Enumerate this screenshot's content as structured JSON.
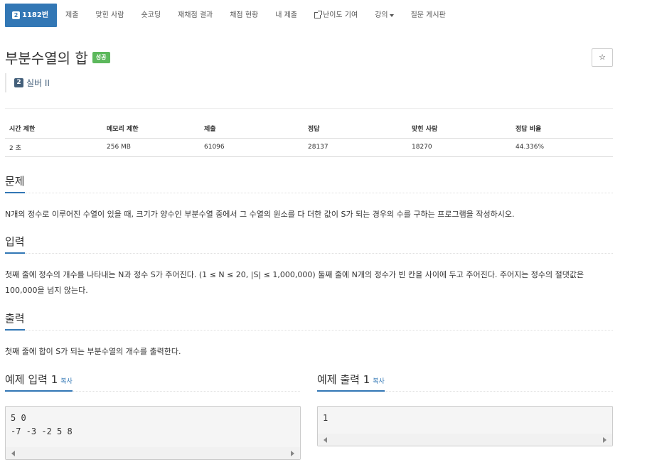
{
  "nav": {
    "problem_id": "1182번",
    "tier_badge": "2",
    "items": [
      "제출",
      "맞힌 사람",
      "숏코딩",
      "재채점 결과",
      "채점 현황",
      "내 제출",
      "난이도 기여",
      "강의"
    ],
    "board": "질문 게시판"
  },
  "problem": {
    "title": "부분수열의 합",
    "result_badge": "성공",
    "star": "☆",
    "tier_number": "2",
    "tier": "실버 II"
  },
  "stats": {
    "headers": [
      "시간 제한",
      "메모리 제한",
      "제출",
      "정답",
      "맞힌 사람",
      "정답 비율"
    ],
    "values": [
      "2 초",
      "256 MB",
      "61096",
      "28137",
      "18270",
      "44.336%"
    ]
  },
  "sections": {
    "problem_title": "문제",
    "problem_text": "N개의 정수로 이루어진 수열이 있을 때, 크기가 양수인 부분수열 중에서 그 수열의 원소를 다 더한 값이 S가 되는 경우의 수를 구하는 프로그램을 작성하시오.",
    "input_title": "입력",
    "input_text": "첫째 줄에 정수의 개수를 나타내는 N과 정수 S가 주어진다. (1 ≤ N ≤ 20, |S| ≤ 1,000,000) 둘째 줄에 N개의 정수가 빈 칸을 사이에 두고 주어진다. 주어지는 정수의 절댓값은 100,000을 넘지 않는다.",
    "output_title": "출력",
    "output_text": "첫째 줄에 합이 S가 되는 부분수열의 개수를 출력한다."
  },
  "examples": {
    "input_title": "예제 입력 1",
    "output_title": "예제 출력 1",
    "copy_label": "복사",
    "input_code": "5 0\n-7 -3 -2 5 8",
    "output_code": "1"
  },
  "colors": {
    "accent": "#3277b5",
    "success": "#5cb85c",
    "tier_silver": "#435f7a"
  }
}
